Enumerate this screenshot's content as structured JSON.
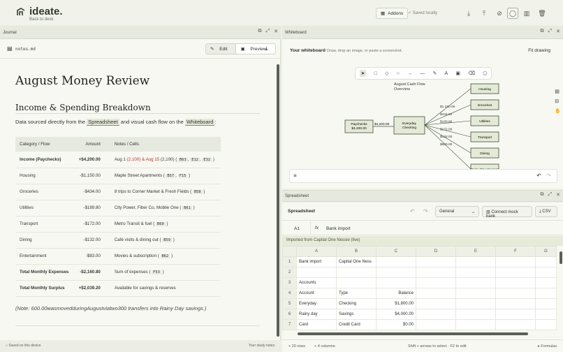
{
  "app": {
    "name": "ideate.",
    "back_label": "Back to desk",
    "addons_label": "Addons",
    "saved_label": "Saved locally"
  },
  "journal": {
    "panel_title": "Journal",
    "filename": "notes.md",
    "edit_label": "Edit",
    "preview_label": "Preview",
    "title": "August Money Review",
    "heading": "Income & Spending Breakdown",
    "intro_prefix": "Data sourced directly from the",
    "intro_link1": "Spreadsheet",
    "intro_mid": "and visual cash flow on the",
    "intro_link2": "Whiteboard",
    "intro_suffix": ":",
    "columns": [
      "Category / Flow",
      "Amount",
      "Notes / Cells"
    ],
    "rows": [
      {
        "cat": "Income (Paychecks)",
        "amt": "+$4,200.00",
        "note": "Aug 1 (2,100) & Aug 15 (2,100) ( B63 , E12 , E32 )"
      },
      {
        "cat": "Housing",
        "amt": "-$1,150.00",
        "note": "Maple Street Apartments ( B57 , F15 )"
      },
      {
        "cat": "Groceries",
        "amt": "-$434.00",
        "note": "8 trips to Corner Market & Fresh Fields ( B58 )"
      },
      {
        "cat": "Utilities",
        "amt": "-$189.80",
        "note": "City Power, Fiber Co, Mobile One ( B61 )"
      },
      {
        "cat": "Transport",
        "amt": "-$172.00",
        "note": "Metro Transit & fuel ( B60 )"
      },
      {
        "cat": "Dining",
        "amt": "-$132.00",
        "note": "Café visits & dining out ( B59 )"
      },
      {
        "cat": "Entertainment",
        "amt": "-$83.00",
        "note": "Movies & subscription ( B62 )"
      },
      {
        "cat": "Total Monthly Expenses",
        "amt": "-$2,160.80",
        "note": "Sum of expenses ( F53 )"
      },
      {
        "cat": "Total Monthly Surplus",
        "amt": "+$2,039.20",
        "note": "Available for savings & reserves"
      }
    ],
    "footnote": "(Note: 600.00wasmovedduringAugustviatwo300 transfers into Rainy Day savings.)",
    "status_left": "Saved on this device",
    "status_right": "Your study notes"
  },
  "whiteboard": {
    "panel_title": "Whiteboard",
    "title": "Your whiteboard",
    "subtitle": "Draw, drop an image, or paste a screenshot.",
    "fit_label": "Fit drawing",
    "diagram_title": "August Cash Flow Overview",
    "source_box": "Paychecks $4,200.00",
    "source_amount": "$4,200.00",
    "hub_box": "Everyday Checking",
    "targets": [
      {
        "label": "Housing",
        "amount": "$1,150.00"
      },
      {
        "label": "Groceries",
        "amount": "$434.00"
      },
      {
        "label": "Utilities",
        "amount": "$189.80"
      },
      {
        "label": "Transport",
        "amount": "$172.00"
      },
      {
        "label": "Dining",
        "amount": "$132.00"
      },
      {
        "label": "Rainy Day Savings",
        "amount": "$600.00"
      }
    ]
  },
  "spreadsheet": {
    "panel_title": "Spreadsheet",
    "title": "Spreadsheet",
    "format_value": "General",
    "connect_label": "Connect mock bank",
    "csv_label": "CSV",
    "cell_ref": "A1",
    "fx_label": "fx",
    "formula_value": "Bank import",
    "imported_banner": "Imported from Capital One Nessie (live)",
    "col_headers": [
      "A",
      "B",
      "C",
      "D",
      "E",
      "F",
      "G"
    ],
    "rows": [
      [
        "1",
        "Bank import",
        "Capital One Ness",
        "",
        "",
        "",
        "",
        ""
      ],
      [
        "2",
        "",
        "",
        "",
        "",
        "",
        "",
        ""
      ],
      [
        "3",
        "Accounts",
        "",
        "",
        "",
        "",
        "",
        ""
      ],
      [
        "4",
        "Account",
        "Type",
        "Balance",
        "",
        "",
        "",
        ""
      ],
      [
        "5",
        "Everyday",
        "Checking",
        "$1,800.00",
        "",
        "",
        "",
        ""
      ],
      [
        "6",
        "Rainy day",
        "Savings",
        "$4,000.00",
        "",
        "",
        "",
        ""
      ],
      [
        "7",
        "Card",
        "Credit Card",
        "$0.00",
        "",
        "",
        "",
        ""
      ]
    ],
    "rows_label": "+ 20 rows",
    "cols_label": "+ 4 columns",
    "hint": "Shift + arrows to select · F2 to edit",
    "formulas_label": "Formulas"
  }
}
